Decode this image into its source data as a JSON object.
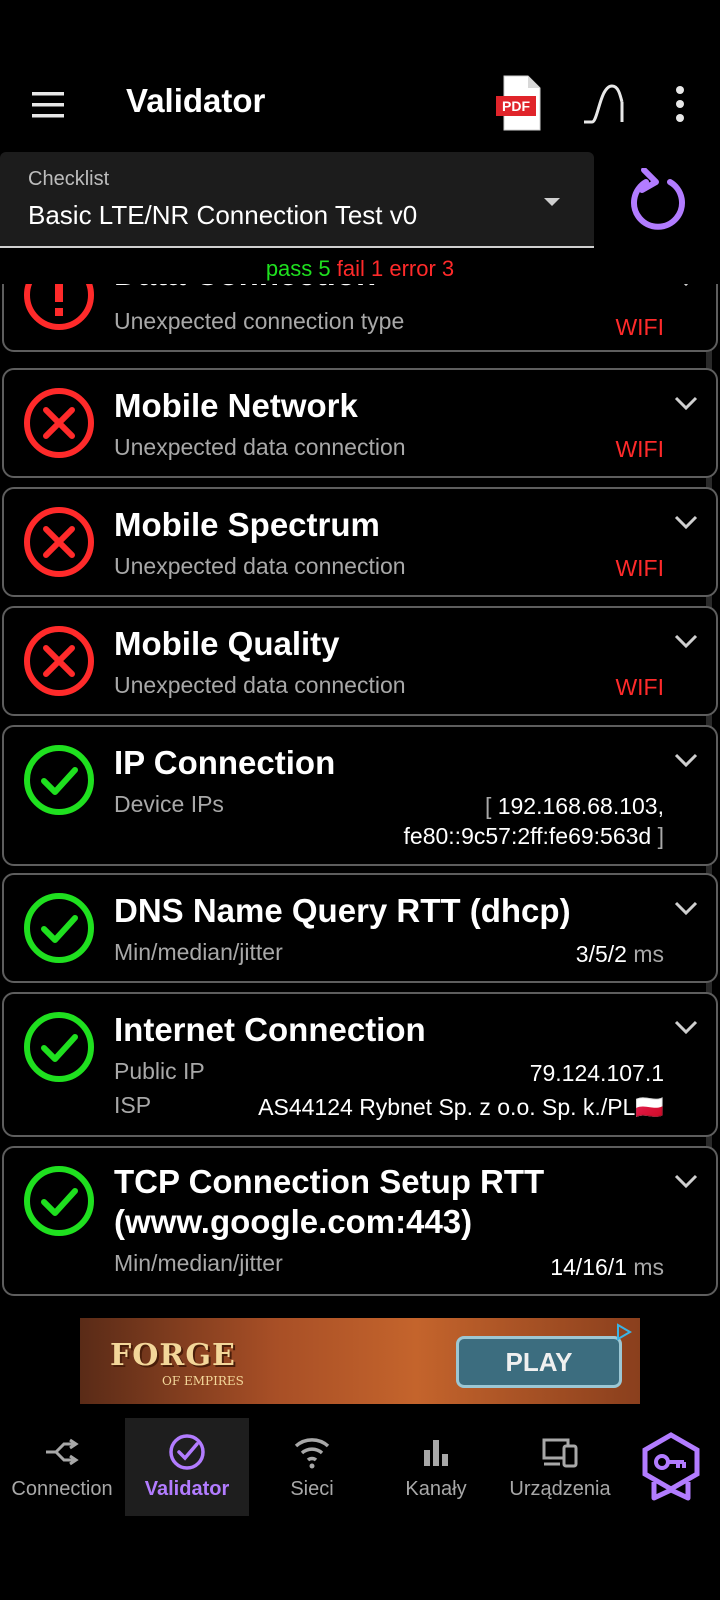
{
  "appbar": {
    "title": "Validator",
    "pdf_label": "PDF",
    "icons": [
      "menu-icon",
      "pdf-icon",
      "curve-icon",
      "more-vert-icon"
    ]
  },
  "checklist": {
    "label": "Checklist",
    "value": "Basic LTE/NR Connection Test v0"
  },
  "summary": {
    "pass": "pass 5",
    "fail": "fail 1",
    "error": "error 3"
  },
  "colors": {
    "pass": "#1fe01f",
    "fail": "#ff2a2a",
    "accent": "#b27cff"
  },
  "cards": [
    {
      "title": "Data Connection",
      "status": "error",
      "rows": [
        {
          "label": "Unexpected connection type",
          "value": "WIFI"
        }
      ]
    },
    {
      "title": "Mobile Network",
      "status": "fail",
      "rows": [
        {
          "label": "Unexpected data connection",
          "value": "WIFI"
        }
      ]
    },
    {
      "title": "Mobile Spectrum",
      "status": "fail",
      "rows": [
        {
          "label": "Unexpected data connection",
          "value": "WIFI"
        }
      ]
    },
    {
      "title": "Mobile Quality",
      "status": "fail",
      "rows": [
        {
          "label": "Unexpected data connection",
          "value": "WIFI"
        }
      ]
    },
    {
      "title": "IP Connection",
      "status": "pass",
      "rows": [
        {
          "label": "Device IPs",
          "value_open": "[",
          "value_line1": "192.168.68.103,",
          "value_line2": "fe80::9c57:2ff:fe69:563d",
          "value_close": "]"
        }
      ]
    },
    {
      "title": "DNS Name Query RTT (dhcp)",
      "status": "pass",
      "rows": [
        {
          "label": "Min/median/jitter",
          "value": "3/5/2",
          "unit": "ms"
        }
      ]
    },
    {
      "title": "Internet Connection",
      "status": "pass",
      "rows": [
        {
          "label": "Public IP",
          "value": "79.124.107.1"
        },
        {
          "label": "ISP",
          "value": "AS44124 Rybnet Sp. z o.o. Sp. k./PL",
          "flag": "🇵🇱"
        }
      ]
    },
    {
      "title": "TCP Connection Setup RTT (www.google.com:443)",
      "status": "pass",
      "rows": [
        {
          "label": "Min/median/jitter",
          "value": "14/16/1",
          "unit": "ms"
        }
      ]
    }
  ],
  "ad": {
    "brand": "FORGE",
    "brand_sub": "OF EMPIRES",
    "cta": "PLAY"
  },
  "bottom_nav": [
    {
      "label": "Connection",
      "icon": "connection-icon",
      "active": false
    },
    {
      "label": "Validator",
      "icon": "validator-icon",
      "active": true
    },
    {
      "label": "Sieci",
      "icon": "wifi-icon",
      "active": false
    },
    {
      "label": "Kanały",
      "icon": "bar-chart-icon",
      "active": false
    },
    {
      "label": "Urządzenia",
      "icon": "devices-icon",
      "active": false
    }
  ]
}
